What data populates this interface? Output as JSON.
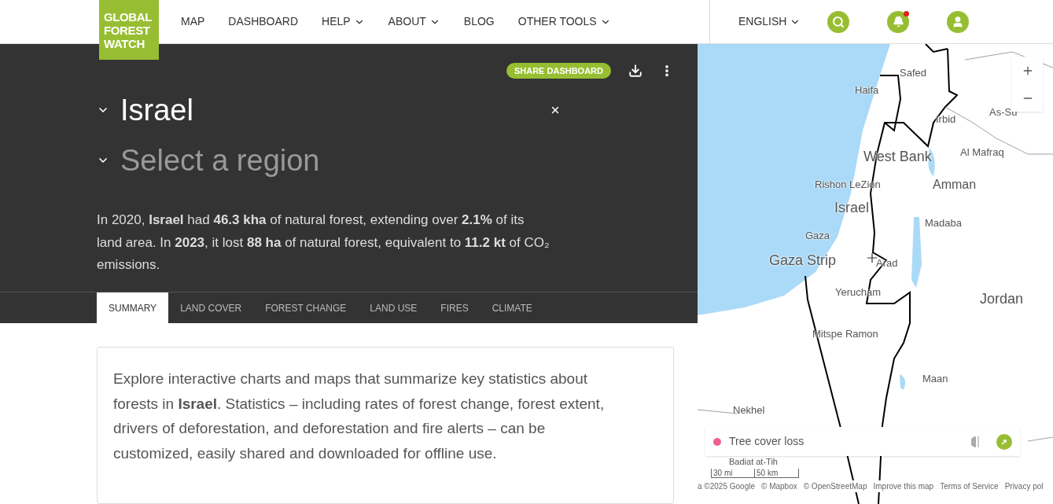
{
  "header": {
    "logo": [
      "GLOBAL",
      "FOREST",
      "WATCH"
    ],
    "nav": [
      {
        "label": "MAP",
        "dropdown": false
      },
      {
        "label": "DASHBOARD",
        "dropdown": false
      },
      {
        "label": "HELP",
        "dropdown": true
      },
      {
        "label": "ABOUT",
        "dropdown": true
      },
      {
        "label": "BLOG",
        "dropdown": false
      },
      {
        "label": "OTHER TOOLS",
        "dropdown": true
      }
    ],
    "language": "ENGLISH",
    "has_notification": true
  },
  "dashboard": {
    "share_button": "SHARE DASHBOARD",
    "country": {
      "value": "Israel"
    },
    "region": {
      "placeholder": "Select a region"
    },
    "summary": "In 2020, **Israel** had **46.3 kha** of natural forest, extending over **2.1%** of its land area. In **2023**, it lost **88 ha** of natural forest, equivalent to **11.2 kt** of CO₂ emissions.",
    "tabs": [
      {
        "label": "SUMMARY",
        "selected": true
      },
      {
        "label": "LAND COVER",
        "selected": false
      },
      {
        "label": "FOREST CHANGE",
        "selected": false
      },
      {
        "label": "LAND USE",
        "selected": false
      },
      {
        "label": "FIRES",
        "selected": false
      },
      {
        "label": "CLIMATE",
        "selected": false
      }
    ],
    "intro": "Explore interactive charts and maps that summarize key statistics about forests in **Israel**. Statistics – including rates of forest change, forest extent, drivers of deforestation, and deforestation and fire alerts – can be customized, easily shared and downloaded for offline use."
  },
  "map": {
    "labels": [
      {
        "text": "Safed",
        "kind": "town"
      },
      {
        "text": "Haifa",
        "kind": "town"
      },
      {
        "text": "Irbid",
        "kind": "town"
      },
      {
        "text": "As-Su",
        "kind": "town"
      },
      {
        "text": "Al Mafraq",
        "kind": "town"
      },
      {
        "text": "West Bank",
        "kind": "region"
      },
      {
        "text": "Rishon LeZion",
        "kind": "town"
      },
      {
        "text": "Amman",
        "kind": "city"
      },
      {
        "text": "Israel",
        "kind": "region"
      },
      {
        "text": "Madaba",
        "kind": "town"
      },
      {
        "text": "Gaza",
        "kind": "town"
      },
      {
        "text": "Gaza Strip",
        "kind": "region"
      },
      {
        "text": "Arad",
        "kind": "town"
      },
      {
        "text": "Yerucham",
        "kind": "town"
      },
      {
        "text": "Jordan",
        "kind": "region"
      },
      {
        "text": "Mitspe Ramon",
        "kind": "town"
      },
      {
        "text": "Maan",
        "kind": "town"
      },
      {
        "text": "Nekhel",
        "kind": "town"
      },
      {
        "text": "Badiat at-Tih",
        "kind": "small"
      }
    ],
    "legend": {
      "label": "Tree cover loss",
      "color": "#f0608f"
    },
    "scale": [
      "30 mi",
      "50 km"
    ],
    "attribution": [
      "a ©2025 Google",
      "© Mapbox",
      "© OpenStreetMap",
      "Improve this map",
      "Terms of Service",
      "Privacy pol"
    ]
  }
}
